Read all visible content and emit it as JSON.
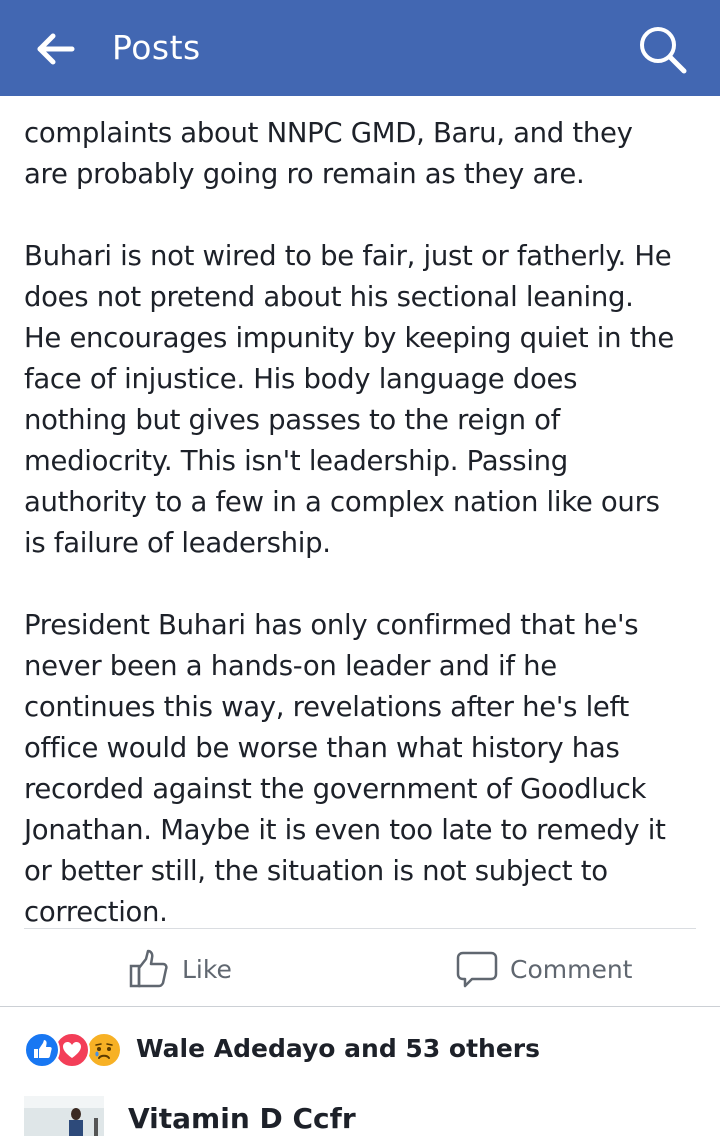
{
  "header": {
    "title": "Posts",
    "back_icon": "arrow-left-icon",
    "search_icon": "search-icon",
    "background": "#4267b2"
  },
  "post": {
    "lines_para1": [
      "complaints about NNPC GMD, Baru, and  they",
      "are probably going ro remain as they are."
    ],
    "lines_para2": [
      "Buhari is not wired to be fair, just or fatherly. He",
      "does not pretend about his sectional leaning.",
      "He encourages impunity by keeping quiet in the",
      "face of injustice. His body language does",
      "nothing but gives passes to the reign of",
      "mediocrity. This isn't leadership. Passing",
      "authority to a few in a complex nation like ours",
      "is failure of leadership."
    ],
    "lines_para3": [
      "President Buhari has only confirmed that he's",
      "never been a hands-on leader and if he",
      "continues this way, revelations after he's left",
      "office would be worse than what history has",
      "recorded against the government of Goodluck",
      "Jonathan. Maybe it is even too late to remedy it",
      "or better still, the situation is not subject to",
      "correction."
    ]
  },
  "actions": {
    "like_label": "Like",
    "comment_label": "Comment",
    "like_icon": "thumbs-up-icon",
    "comment_icon": "speech-bubble-icon"
  },
  "reactions": {
    "icons": [
      "like-reaction-icon",
      "love-reaction-icon",
      "sad-reaction-icon"
    ],
    "summary": "Wale Adedayo and 53 others",
    "colors": {
      "like": "#1877f2",
      "love": "#f33e58",
      "sad": "#f7b125"
    }
  },
  "comment": {
    "author": "Vitamin D Ccfr"
  }
}
